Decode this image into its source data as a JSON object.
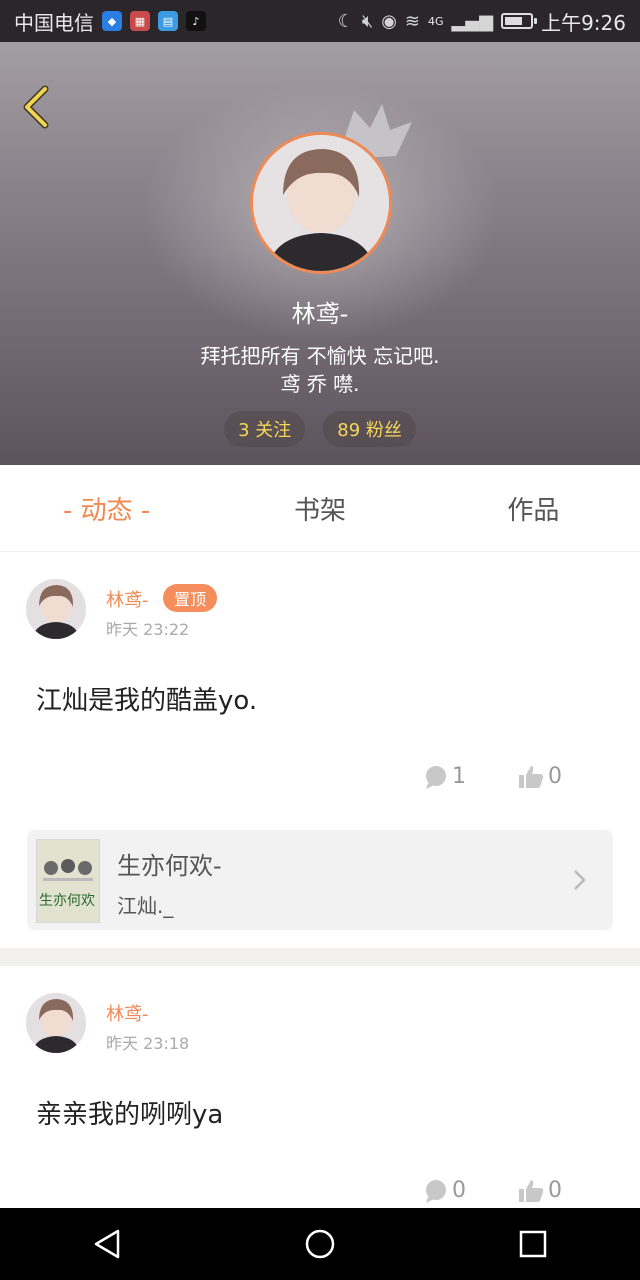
{
  "status_bar": {
    "carrier": "中国电信",
    "network": "4G",
    "time": "上午9:26"
  },
  "profile": {
    "name": "林鸢-",
    "bio_line1": "拜托把所有 不愉快 忘记吧.",
    "bio_line2": "鸢 乔 噤.",
    "following": "3 关注",
    "followers": "89 粉丝"
  },
  "tabs": [
    {
      "label": "- 动态 -",
      "active": true
    },
    {
      "label": "书架",
      "active": false
    },
    {
      "label": "作品",
      "active": false
    }
  ],
  "posts": [
    {
      "author": "林鸢-",
      "pinned_label": "置顶",
      "time": "昨天 23:22",
      "text": "江灿是我的酷盖yo.",
      "comments": "1",
      "likes": "0",
      "book": {
        "title": "生亦何欢-",
        "author": "江灿._",
        "cover_text": "生亦何欢"
      }
    },
    {
      "author": "林鸢-",
      "time": "昨天 23:18",
      "text": "亲亲我的咧咧ya",
      "comments": "0",
      "likes": "0"
    }
  ],
  "colors": {
    "accent": "#f0884f",
    "pill_text": "#f6d65a"
  }
}
